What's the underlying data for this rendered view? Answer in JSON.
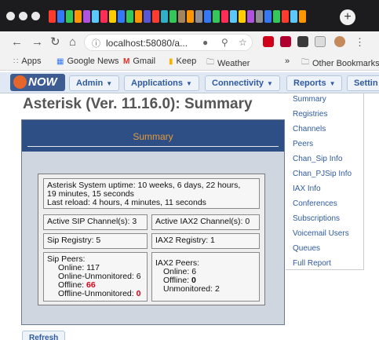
{
  "browser": {
    "new_tab_symbol": "+",
    "url": "localhost:58080/a...",
    "tab_favicon_colors": [
      "#ff3b30",
      "#3478f6",
      "#34c759",
      "#ff9500",
      "#af52de",
      "#5ac8fa",
      "#ff2d55",
      "#ffcc00",
      "#3478f6",
      "#34c759",
      "#ff9500",
      "#5856d6",
      "#ff3b30",
      "#30b0c7",
      "#34c759",
      "#a2845e",
      "#ff9500",
      "#8e8e93",
      "#3478f6",
      "#34c759",
      "#ff2d55",
      "#5ac8fa",
      "#ffcc00",
      "#af52de",
      "#8e8e93",
      "#3478f6",
      "#34c759",
      "#ff3b30",
      "#5ac8fa",
      "#ff9500"
    ],
    "bookmarks": [
      {
        "label": "Apps",
        "icon": "apps-grid-icon"
      },
      {
        "label": "Google News",
        "icon": "google-news-icon"
      },
      {
        "label": "Gmail",
        "icon": "gmail-icon"
      },
      {
        "label": "Keep",
        "icon": "keep-icon"
      },
      {
        "label": "Weather",
        "icon": "folder-icon"
      },
      {
        "label": "Other Bookmarks",
        "icon": "folder-icon"
      }
    ],
    "bookmarks_overflow": "»"
  },
  "app": {
    "logo_text": "NOW",
    "menu": [
      {
        "label": "Admin"
      },
      {
        "label": "Applications"
      },
      {
        "label": "Connectivity"
      },
      {
        "label": "Reports"
      },
      {
        "label": "Settin"
      }
    ],
    "page_title": "Asterisk (Ver. 11.16.0): Summary",
    "panel_title": "Summary",
    "sidebar": [
      "Summary",
      "Registries",
      "Channels",
      "Peers",
      "Chan_Sip Info",
      "Chan_PJSip Info",
      "IAX Info",
      "Conferences",
      "Subscriptions",
      "Voicemail Users",
      "Queues",
      "Full Report"
    ],
    "summary": {
      "uptime": "Asterisk System uptime: 10 weeks, 6 days, 22 hours,",
      "uptime_2": "19 minutes, 15 seconds",
      "last_reload": "Last reload: 4 hours, 4 minutes, 11 seconds",
      "active_sip": "Active SIP Channel(s): 3",
      "active_iax2": "Active IAX2 Channel(s): 0",
      "sip_registry": "Sip Registry: 5",
      "iax2_registry": "IAX2 Registry: 1",
      "sip_peers": {
        "heading": "Sip Peers:",
        "online_label": "Online: ",
        "online_value": "117",
        "online_unmon_label": "Online-Unmonitored: ",
        "online_unmon_value": "6",
        "offline_label": "Offline: ",
        "offline_value": "66",
        "offline_unmon_label": "Offline-Unmonitored: ",
        "offline_unmon_value": "0"
      },
      "iax2_peers": {
        "heading": "IAX2 Peers:",
        "online_label": "Online: ",
        "online_value": "6",
        "offline_label": "Offline: ",
        "offline_value": "0",
        "unmon_label": "Unmonitored: ",
        "unmon_value": "2"
      }
    },
    "refresh_label": "Refresh"
  }
}
